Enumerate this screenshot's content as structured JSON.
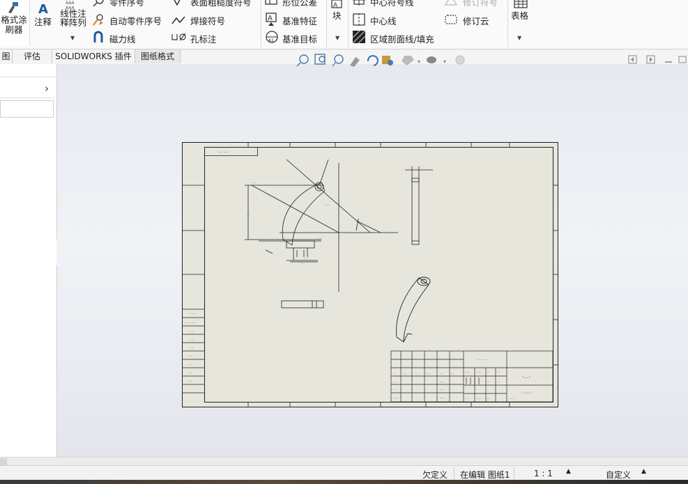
{
  "ribbon": {
    "format_painter": "格式涂\n刷器",
    "note": "注释",
    "linear_note_array": "线性注\n释阵列",
    "balloon": "零件序号",
    "auto_balloon": "自动零件序号",
    "magnetic_line": "磁力线",
    "surface_finish": "表面粗糙度符号",
    "weld_symbol": "焊接符号",
    "hole_callout": "孔标注",
    "gtol": "形位公差",
    "datum_feature": "基准特征",
    "datum_target": "基准目标",
    "block": "块",
    "centermark": "中心符号线",
    "centerline": "中心线",
    "area_hatch": "区域剖面线/填充",
    "revision_symbol": "修订符号",
    "revision_cloud": "修订云",
    "tables": "表格"
  },
  "tabs": [
    "图",
    "评估",
    "SOLIDWORKS 插件",
    "图纸格式"
  ],
  "status": {
    "under_defined": "欠定义",
    "editing": "在编辑 图纸1",
    "scale": "1 : 1",
    "custom": "自定义"
  },
  "drawing": {
    "title_note": "- -- -- -",
    "title_cell": "\" ---- \"",
    "title_cell2": "\" ----- \""
  },
  "colors": {
    "sheet_bg": "#e6e6dc",
    "canvas_top": "#e6e9ef",
    "accent_icon": "#1d5a9c"
  }
}
